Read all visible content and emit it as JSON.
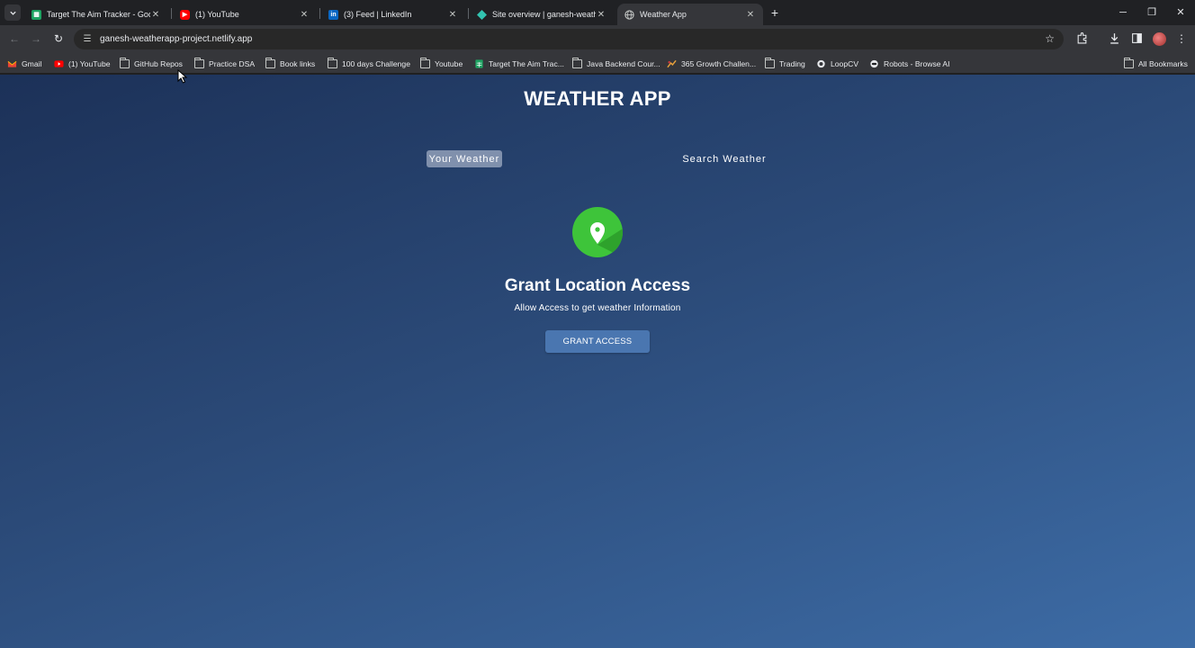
{
  "browser": {
    "tabs": [
      {
        "title": "Target The Aim Tracker - Googl",
        "favicon": "sheets-icon",
        "active": false
      },
      {
        "title": "(1) YouTube",
        "favicon": "youtube-icon",
        "active": false
      },
      {
        "title": "(3) Feed | LinkedIn",
        "favicon": "linkedin-icon",
        "active": false
      },
      {
        "title": "Site overview | ganesh-weathe",
        "favicon": "netlify-icon",
        "active": false
      },
      {
        "title": "Weather App",
        "favicon": "globe-icon",
        "active": true
      }
    ],
    "new_tab": "+",
    "url": "ganesh-weatherapp-project.netlify.app",
    "bookmarks": [
      {
        "label": "Gmail",
        "icon": "gmail-icon"
      },
      {
        "label": "(1) YouTube",
        "icon": "youtube-icon"
      },
      {
        "label": "GitHub Repos",
        "icon": "folder-icon"
      },
      {
        "label": "Practice DSA",
        "icon": "folder-icon"
      },
      {
        "label": "Book links",
        "icon": "folder-icon"
      },
      {
        "label": "100 days Challenge",
        "icon": "folder-icon"
      },
      {
        "label": "Youtube",
        "icon": "folder-icon"
      },
      {
        "label": "Target The Aim Trac...",
        "icon": "sheets-icon"
      },
      {
        "label": "Java Backend Cour...",
        "icon": "folder-icon"
      },
      {
        "label": "365 Growth Challen...",
        "icon": "growth-icon"
      },
      {
        "label": "Trading",
        "icon": "folder-icon"
      },
      {
        "label": "LoopCV",
        "icon": "loopcv-icon"
      },
      {
        "label": "Robots - Browse AI",
        "icon": "browse-ai-icon"
      }
    ],
    "all_bookmarks": "All Bookmarks"
  },
  "page": {
    "title": "WEATHER APP",
    "tabs": {
      "your_weather": "Your Weather",
      "search_weather": "Search Weather"
    },
    "grant": {
      "heading": "Grant Location Access",
      "subtext": "Allow Access to get weather Information",
      "button": "GRANT ACCESS"
    }
  },
  "colors": {
    "browser_frame": "#202124",
    "toolbar": "#35363a",
    "page_gradient_start": "#1c3158",
    "page_gradient_end": "#3d6ca6",
    "location_icon_green": "#3ec43a",
    "grant_button": "#4a76b0"
  }
}
